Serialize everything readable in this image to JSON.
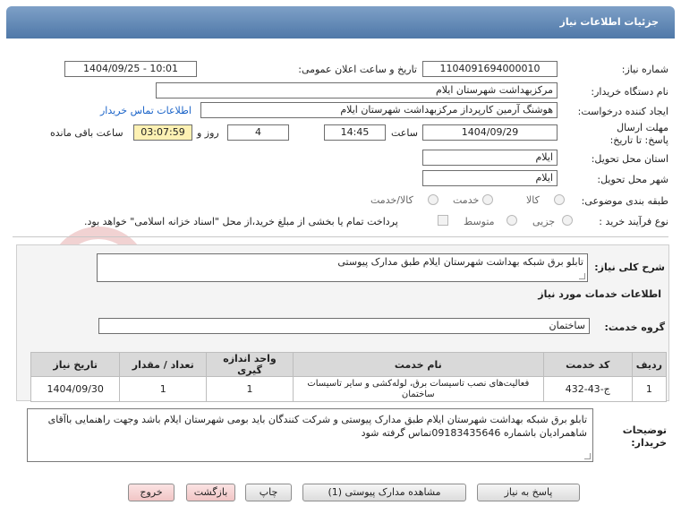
{
  "header": {
    "title": "جزئیات اطلاعات نیاز"
  },
  "form": {
    "need_number_label": "شماره نیاز:",
    "need_number": "1104091694000010",
    "announce_label": "تاریخ و ساعت اعلان عمومی:",
    "announce_value": "1404/09/25 - 10:01",
    "buyer_org_label": "نام دستگاه خریدار:",
    "buyer_org": "مرکزبهداشت شهرستان ایلام",
    "requester_label": "ایجاد کننده درخواست:",
    "requester": "هوشنگ آرمین کارپرداز مرکزبهداشت شهرستان ایلام",
    "contact_link": "اطلاعات تماس خریدار",
    "deadline_label": "مهلت ارسال پاسخ: تا تاریخ:",
    "deadline_date": "1404/09/29",
    "time_label": "ساعت",
    "deadline_time": "14:45",
    "days_value": "4",
    "days_label": "روز و",
    "remaining_time": "03:07:59",
    "remaining_label": "ساعت باقی مانده",
    "province_label": "استان محل تحویل:",
    "province": "ایلام",
    "city_label": "شهر محل تحویل:",
    "city": "ایلام",
    "category_label": "طبقه بندی موضوعی:",
    "category_options": [
      "کالا",
      "خدمت",
      "کالا/خدمت"
    ],
    "process_label": "نوع فرآیند خرید :",
    "process_options": [
      "جزیی",
      "متوسط"
    ],
    "payment_note": "پرداخت تمام یا بخشی از مبلغ خرید،از محل \"اسناد خزانه اسلامی\" خواهد بود."
  },
  "summary": {
    "label": "شرح کلی نیاز:",
    "value": "تابلو برق شبکه بهداشت شهرستان ایلام طبق مدارک پیوستی"
  },
  "services": {
    "section_title": "اطلاعات خدمات مورد نیاز",
    "group_label": "گروه خدمت:",
    "group_value": "ساختمان",
    "columns": [
      "ردیف",
      "کد خدمت",
      "نام خدمت",
      "واحد اندازه گیری",
      "تعداد / مقدار",
      "تاریخ نیاز"
    ],
    "rows": [
      [
        "1",
        "ج-43-432",
        "فعالیت‌های نصب تاسیسات برق، لوله‌کشی و سایر تاسیسات ساختمان",
        "1",
        "1",
        "1404/09/30"
      ]
    ]
  },
  "notes": {
    "label": "توضیحات خریدار:",
    "text": "تابلو برق شبکه بهداشت شهرستان ایلام طبق مدارک پیوستی و شرکت کنندگان باید بومی شهرستان ایلام باشد وجهت راهنمایی باآقای شاهمرادیان باشماره 09183435646تماس گرفته شود"
  },
  "buttons": {
    "reply": "پاسخ به نیاز",
    "view_docs": "مشاهده مدارک پیوستی (1)",
    "print": "چاپ",
    "back": "بازگشت",
    "exit": "خروج"
  },
  "watermark": {
    "text": "AriaTender.net"
  },
  "colors": {
    "title_bar": "#5a81b0",
    "link": "#1a63c8",
    "highlight": "#fdf1b3",
    "table_header": "#d9d9d9"
  }
}
